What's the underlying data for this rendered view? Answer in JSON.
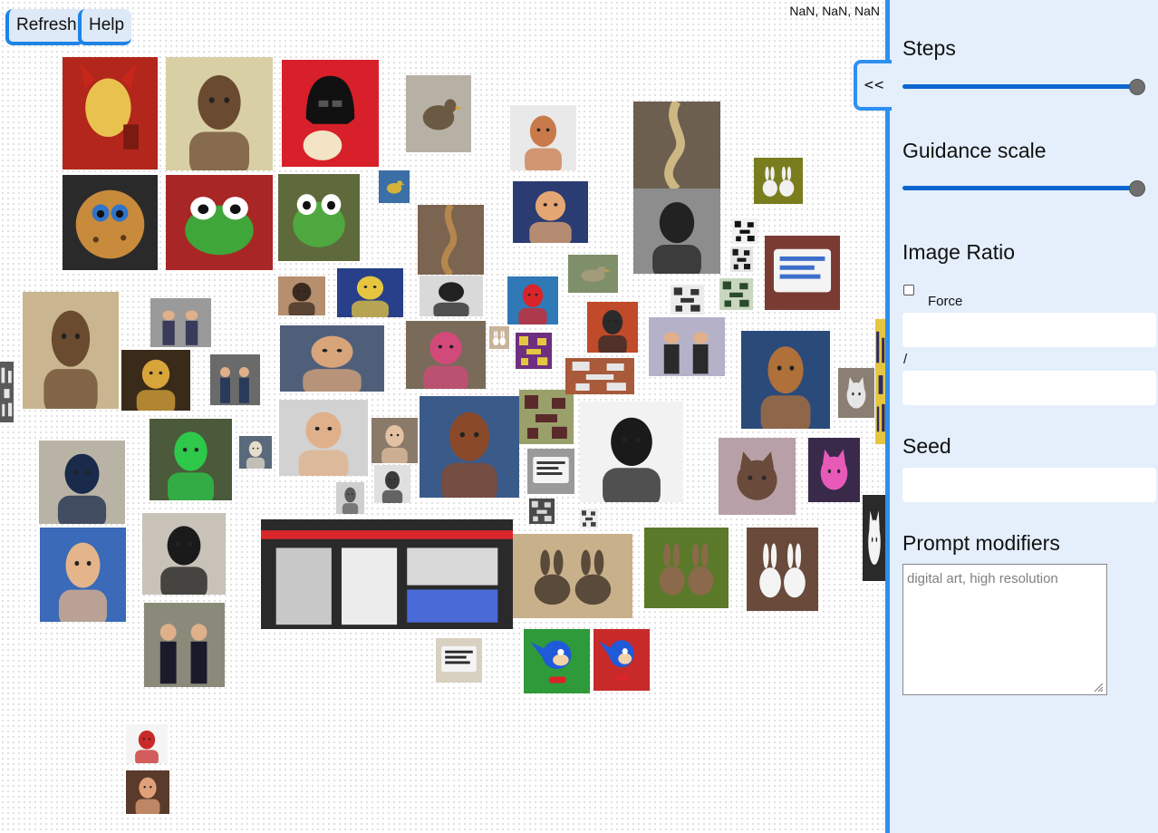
{
  "toolbar": {
    "refresh_label": "Refresh",
    "help_label": "Help",
    "coordinates": "NaN, NaN, NaN"
  },
  "panel": {
    "collapse_label": "<<",
    "steps_label": "Steps",
    "steps_value_fraction": 1.0,
    "guidance_label": "Guidance scale",
    "guidance_value_fraction": 1.0,
    "ratio_label": "Image Ratio",
    "force_label": "Force",
    "force_checked": false,
    "ratio_width_value": "",
    "ratio_separator": "/",
    "ratio_height_value": "",
    "seed_label": "Seed",
    "seed_value": "",
    "modifiers_label": "Prompt modifiers",
    "modifiers_placeholder": "digital art, high resolution",
    "accent_color": "#2f8ff0",
    "panel_bg": "#e4effb"
  },
  "gallery": {
    "tiles": [
      {
        "name": "devil-figure",
        "subject": "devil",
        "bg": "#b2261b",
        "fg": "#e8c14e"
      },
      {
        "name": "jesus-cartoon",
        "subject": "person",
        "bg": "#d9cfa5",
        "fg": "#6b4a32"
      },
      {
        "name": "darth-vader-clown",
        "subject": "helmet",
        "bg": "#d8202a",
        "fg": "#111111"
      },
      {
        "name": "bird-photo",
        "subject": "bird",
        "bg": "#b7b1a5",
        "fg": "#6b5a43"
      },
      {
        "name": "trump-poster",
        "subject": "portrait",
        "bg": "#e9e9e9",
        "fg": "#c97a4a"
      },
      {
        "name": "rope-knot",
        "subject": "rope",
        "bg": "#6c5f4f",
        "fg": "#cdb783"
      },
      {
        "name": "rabbits-green",
        "subject": "rabbit",
        "bg": "#7a7d1e",
        "fg": "#f1f1f1"
      },
      {
        "name": "cookie-monster",
        "subject": "cookie",
        "bg": "#c88a3b",
        "fg": "#2f74c8"
      },
      {
        "name": "frog-cartoon",
        "subject": "frog",
        "bg": "#a92626",
        "fg": "#3fa63a"
      },
      {
        "name": "kermit",
        "subject": "frog",
        "bg": "#5e6a3c",
        "fg": "#4ea83f"
      },
      {
        "name": "duck-small",
        "subject": "bird",
        "bg": "#3c6fa6",
        "fg": "#d5b238"
      },
      {
        "name": "rope-hanging",
        "subject": "rope",
        "bg": "#7b6450",
        "fg": "#b5874f"
      },
      {
        "name": "trump-collage",
        "subject": "portrait",
        "bg": "#2a3c72",
        "fg": "#e4a673"
      },
      {
        "name": "karl-marx-bw",
        "subject": "portrait",
        "bg": "#8d8d8d",
        "fg": "#222222"
      },
      {
        "name": "pixel-bw-1",
        "subject": "pixel",
        "bg": "#f1f1f1",
        "fg": "#111111"
      },
      {
        "name": "pixel-bw-2",
        "subject": "pixel",
        "bg": "#e6e6e6",
        "fg": "#1a1a1a"
      },
      {
        "name": "tablet-screen",
        "subject": "screen",
        "bg": "#7a3b33",
        "fg": "#3e6ec9"
      },
      {
        "name": "jesus-painting",
        "subject": "person",
        "bg": "#c9b58f",
        "fg": "#6a4b2f"
      },
      {
        "name": "boy-portrait",
        "subject": "portrait",
        "bg": "#b68f6f",
        "fg": "#3a2a1f"
      },
      {
        "name": "obama-poster",
        "subject": "portrait",
        "bg": "#28408a",
        "fg": "#e6c640"
      },
      {
        "name": "poe-portrait",
        "subject": "portrait",
        "bg": "#d9d9d9",
        "fg": "#222222"
      },
      {
        "name": "santa",
        "subject": "portrait",
        "bg": "#2f79b6",
        "fg": "#d8242a"
      },
      {
        "name": "bird-branch",
        "subject": "bird",
        "bg": "#7f8f6a",
        "fg": "#a39a7a"
      },
      {
        "name": "street-scene",
        "subject": "crowd",
        "bg": "#9a9a9a",
        "fg": "#3a3a5a"
      },
      {
        "name": "jesus-gold",
        "subject": "person",
        "bg": "#3a2a1a",
        "fg": "#d8a53b"
      },
      {
        "name": "two-men",
        "subject": "crowd",
        "bg": "#6a6a6a",
        "fg": "#2a3a5a"
      },
      {
        "name": "sarkozy",
        "subject": "portrait",
        "bg": "#4f5f7a",
        "fg": "#d8a47a"
      },
      {
        "name": "girl-pink-coat",
        "subject": "person",
        "bg": "#7a6a5a",
        "fg": "#d24a7a"
      },
      {
        "name": "mini-rabbit",
        "subject": "rabbit",
        "bg": "#c8b39a",
        "fg": "#ffffff"
      },
      {
        "name": "mini-purple",
        "subject": "pixel",
        "bg": "#6d2f7f",
        "fg": "#e6c640"
      },
      {
        "name": "marx-small",
        "subject": "portrait",
        "bg": "#c04a2a",
        "fg": "#2a2a2a"
      },
      {
        "name": "four-band",
        "subject": "crowd",
        "bg": "#b5b1c8",
        "fg": "#2a2a2a"
      },
      {
        "name": "pixel-group",
        "subject": "pixel",
        "bg": "#ececec",
        "fg": "#333333"
      },
      {
        "name": "pixel-green",
        "subject": "pixel",
        "bg": "#c9d6c0",
        "fg": "#2a4a2a"
      },
      {
        "name": "jesus-muscular",
        "subject": "person",
        "bg": "#2a4a7a",
        "fg": "#b0703a"
      },
      {
        "name": "cat-small",
        "subject": "cat",
        "bg": "#8a7f72",
        "fg": "#e6e6e6"
      },
      {
        "name": "yellow-strip",
        "subject": "pixel",
        "bg": "#e6c640",
        "fg": "#2a2a6a"
      },
      {
        "name": "knight-jesus",
        "subject": "person",
        "bg": "#4a5a3a",
        "fg": "#2ec84a"
      },
      {
        "name": "hollande-sitting",
        "subject": "portrait",
        "bg": "#b9b3a5",
        "fg": "#1a2a4a"
      },
      {
        "name": "merkel",
        "subject": "portrait",
        "bg": "#5a6a7a",
        "fg": "#e6dccc"
      },
      {
        "name": "macron-smile",
        "subject": "portrait",
        "bg": "#d2d2d2",
        "fg": "#e0b08a"
      },
      {
        "name": "kid-small",
        "subject": "portrait",
        "bg": "#8a7a6a",
        "fg": "#e2c2a2"
      },
      {
        "name": "macron-podium",
        "subject": "portrait",
        "bg": "#3a5a8a",
        "fg": "#8a4a2a"
      },
      {
        "name": "mini-cluster-a",
        "subject": "pixel",
        "bg": "#9aa06a",
        "fg": "#5a2a2a"
      },
      {
        "name": "mini-cluster-b",
        "subject": "pixel",
        "bg": "#a85a3a",
        "fg": "#e6e6e6"
      },
      {
        "name": "marx-drawing",
        "subject": "portrait",
        "bg": "#f2f2f2",
        "fg": "#1a1a1a"
      },
      {
        "name": "girl-cat",
        "subject": "cat",
        "bg": "#b8a0a8",
        "fg": "#6a4a3a"
      },
      {
        "name": "colorful-cat",
        "subject": "cat",
        "bg": "#3a2a4a",
        "fg": "#e85ab8"
      },
      {
        "name": "baby-bw",
        "subject": "portrait",
        "bg": "#cfcfcf",
        "fg": "#5a5a5a"
      },
      {
        "name": "baby-bw-2",
        "subject": "portrait",
        "bg": "#e0e0e0",
        "fg": "#3a3a3a"
      },
      {
        "name": "sign-gray",
        "subject": "screen",
        "bg": "#9a9a9a",
        "fg": "#3a3a3a"
      },
      {
        "name": "hollande-cartoon",
        "subject": "portrait",
        "bg": "#3a6ab8",
        "fg": "#e4b48a"
      },
      {
        "name": "hollande-wave",
        "subject": "portrait",
        "bg": "#c8c2b8",
        "fg": "#1a1a1a"
      },
      {
        "name": "glitch-panel",
        "subject": "glitch",
        "bg": "#2a2a2a",
        "fg": "#d8262a"
      },
      {
        "name": "two-rabbits-field",
        "subject": "rabbit",
        "bg": "#c8b08a",
        "fg": "#5a4a3a"
      },
      {
        "name": "rabbits-grass",
        "subject": "rabbit",
        "bg": "#5a7a2a",
        "fg": "#8a6a4a"
      },
      {
        "name": "white-rabbits",
        "subject": "rabbit",
        "bg": "#6a4a3a",
        "fg": "#f4f4f4"
      },
      {
        "name": "dog-bw",
        "subject": "cat",
        "bg": "#2a2a2a",
        "fg": "#f4f4f4"
      },
      {
        "name": "politicians-walk",
        "subject": "crowd",
        "bg": "#8a8a7a",
        "fg": "#1a1a2a"
      },
      {
        "name": "paper-note",
        "subject": "screen",
        "bg": "#d8d0c0",
        "fg": "#2a2a2a"
      },
      {
        "name": "sonic-green",
        "subject": "sonic",
        "bg": "#2f9a3a",
        "fg": "#1f5ad8"
      },
      {
        "name": "sonic-red",
        "subject": "sonic",
        "bg": "#c82a2a",
        "fg": "#1f5ad8"
      },
      {
        "name": "time-trump",
        "subject": "portrait",
        "bg": "#f4f4f4",
        "fg": "#c82a2a"
      },
      {
        "name": "trump-small",
        "subject": "portrait",
        "bg": "#5a3a2a",
        "fg": "#e0a07a"
      },
      {
        "name": "edge-left",
        "subject": "pixel",
        "bg": "#5a5a5a",
        "fg": "#e6e6e6"
      },
      {
        "name": "mini-dark",
        "subject": "pixel",
        "bg": "#4a4a4a",
        "fg": "#d8d8d8"
      },
      {
        "name": "mini-white",
        "subject": "pixel",
        "bg": "#eeeeee",
        "fg": "#444444"
      }
    ]
  }
}
